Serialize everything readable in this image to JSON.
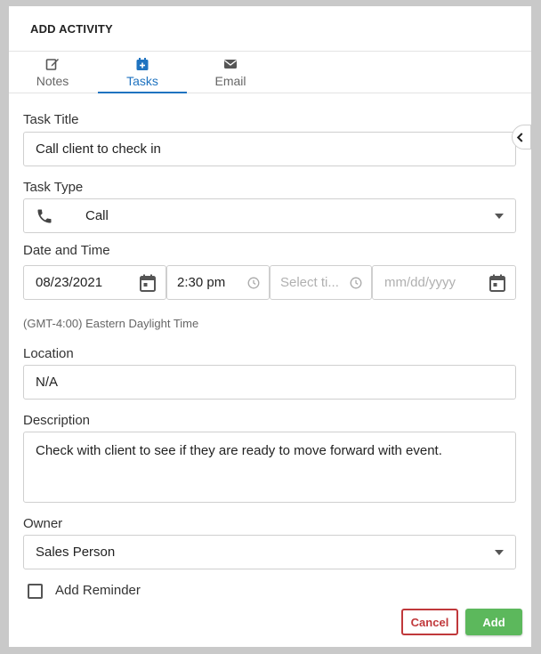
{
  "header": {
    "title": "ADD ACTIVITY"
  },
  "tabs": [
    {
      "label": "Notes",
      "icon": "edit-icon"
    },
    {
      "label": "Tasks",
      "icon": "calendar-plus-icon"
    },
    {
      "label": "Email",
      "icon": "envelope-icon"
    }
  ],
  "active_tab": "Tasks",
  "form": {
    "task_title": {
      "label": "Task Title",
      "value": "Call client to check in"
    },
    "task_type": {
      "label": "Task Type",
      "value": "Call",
      "icon": "phone-icon"
    },
    "date_time": {
      "label": "Date and Time",
      "start_date": "08/23/2021",
      "start_time": "2:30 pm",
      "end_time_placeholder": "Select ti...",
      "end_date_placeholder": "mm/dd/yyyy",
      "timezone": "(GMT-4:00) Eastern Daylight Time"
    },
    "location": {
      "label": "Location",
      "value": "N/A"
    },
    "description": {
      "label": "Description",
      "value": "Check with client to see if they are ready to move forward with event."
    },
    "owner": {
      "label": "Owner",
      "value": "Sales Person"
    },
    "reminder": {
      "label": "Add Reminder",
      "checked": false
    }
  },
  "buttons": {
    "cancel": "Cancel",
    "add": "Add"
  },
  "colors": {
    "accent": "#1f73c0",
    "cancel": "#c0383b",
    "add": "#5cb85c"
  }
}
